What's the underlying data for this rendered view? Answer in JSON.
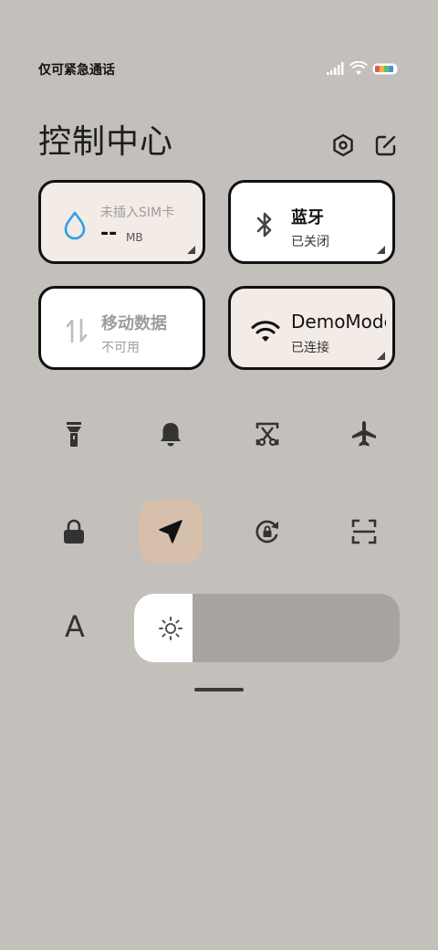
{
  "status": {
    "carrier_text": "仅可紧急通话"
  },
  "header": {
    "title": "控制中心"
  },
  "tiles": {
    "data_usage": {
      "label": "未插入SIM卡",
      "value": "--",
      "unit": "MB"
    },
    "bluetooth": {
      "label": "蓝牙",
      "state": "已关闭"
    },
    "mobile_data": {
      "label": "移动数据",
      "state": "不可用"
    },
    "wifi": {
      "label": "DemoMode",
      "state": "已连接"
    }
  },
  "toggles": [
    {
      "name": "flashlight-icon"
    },
    {
      "name": "bell-icon"
    },
    {
      "name": "screenshot-icon"
    },
    {
      "name": "airplane-icon"
    },
    {
      "name": "lock-icon"
    },
    {
      "name": "location-icon",
      "active": true
    },
    {
      "name": "rotation-lock-icon"
    },
    {
      "name": "scanner-icon"
    }
  ],
  "brightness": {
    "font_label": "A",
    "level": 0.22
  },
  "colors": {
    "background": "#c3bfbb",
    "active_toggle": "#d6bfab",
    "accent_blue": "#2aa2e6"
  }
}
